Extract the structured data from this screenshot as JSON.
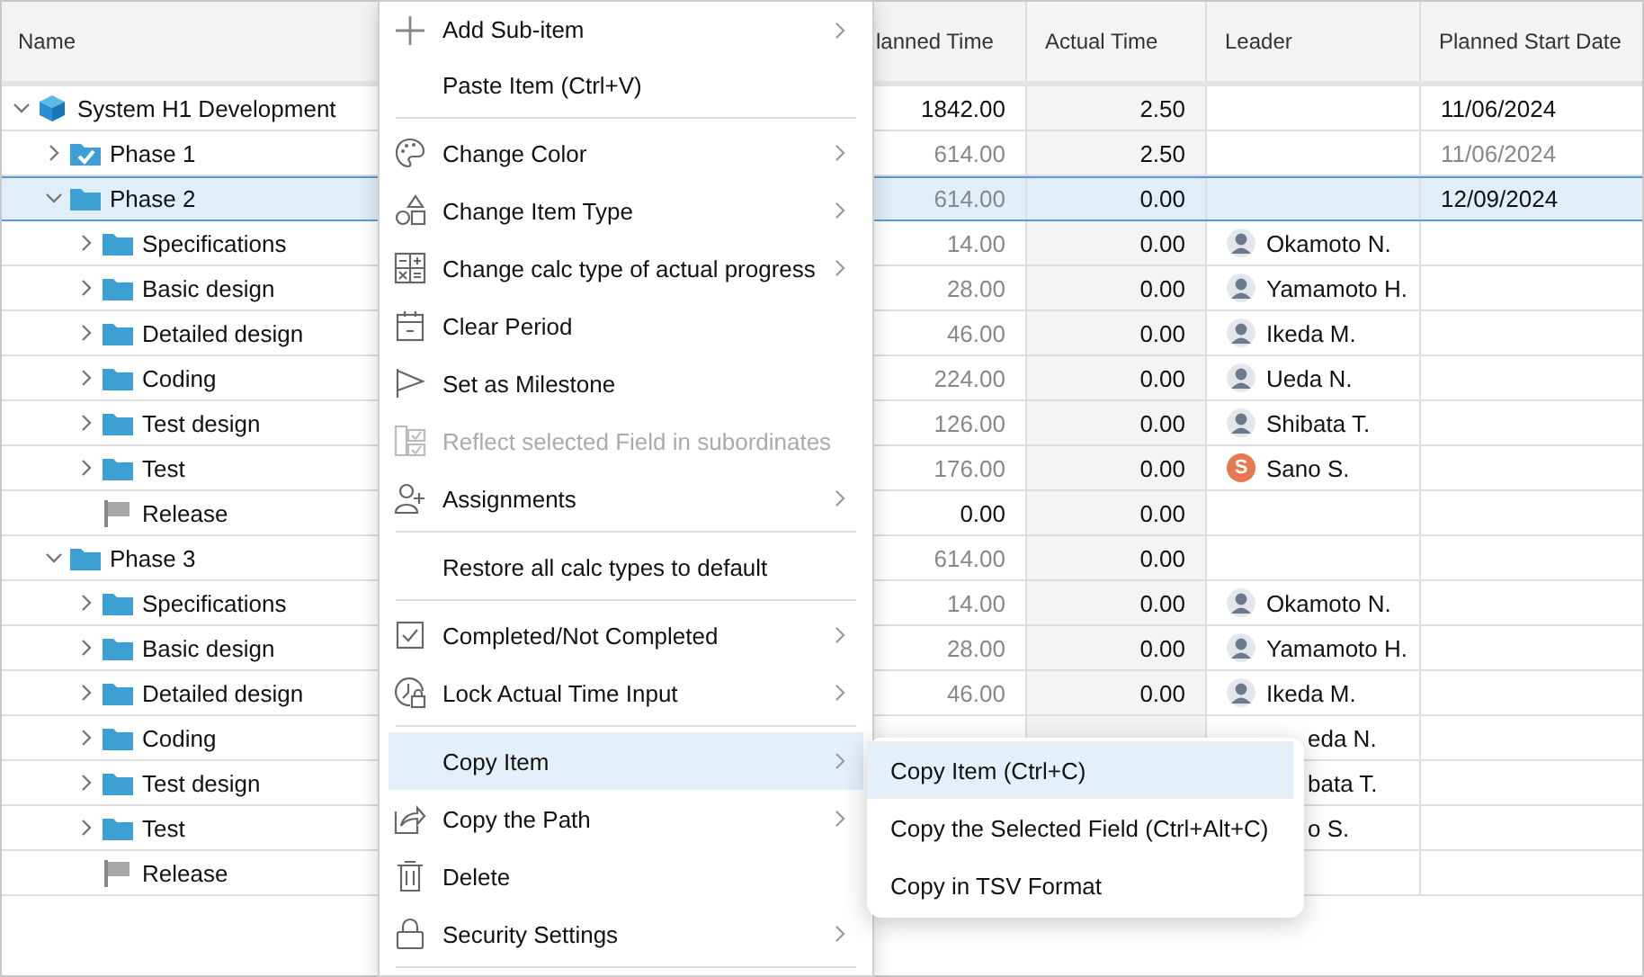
{
  "table": {
    "columns": [
      {
        "label": "Name"
      },
      {
        "label": "lanned Time"
      },
      {
        "label": "Actual Time"
      },
      {
        "label": "Leader"
      },
      {
        "label": "Planned Start Date"
      }
    ],
    "tree": [
      {
        "name": "System H1 Development",
        "kind": "project",
        "expanded": true,
        "selected": false,
        "planned_time": {
          "text": "1842.00",
          "computed": false
        },
        "actual_time": "2.50",
        "start_date": {
          "text": "11/06/2024",
          "computed": false
        },
        "children": [
          {
            "name": "Phase 1",
            "kind": "done-folder",
            "expanded": false,
            "selected": false,
            "planned_time": {
              "text": "614.00",
              "computed": true
            },
            "actual_time": "2.50",
            "start_date": {
              "text": "11/06/2024",
              "computed": true
            }
          },
          {
            "name": "Phase 2",
            "kind": "folder",
            "expanded": true,
            "selected": true,
            "planned_time": {
              "text": "614.00",
              "computed": true
            },
            "actual_time": "0.00",
            "start_date": {
              "text": "12/09/2024",
              "computed": false
            },
            "children": [
              {
                "name": "Specifications",
                "kind": "folder",
                "expanded": false,
                "selected": false,
                "planned_time": {
                  "text": "14.00",
                  "computed": true
                },
                "actual_time": "0.00",
                "leader": {
                  "name": "Okamoto N.",
                  "kind": "figure"
                }
              },
              {
                "name": "Basic design",
                "kind": "folder",
                "expanded": false,
                "selected": false,
                "planned_time": {
                  "text": "28.00",
                  "computed": true
                },
                "actual_time": "0.00",
                "leader": {
                  "name": "Yamamoto H.",
                  "kind": "figure"
                }
              },
              {
                "name": "Detailed design",
                "kind": "folder",
                "expanded": false,
                "selected": false,
                "planned_time": {
                  "text": "46.00",
                  "computed": true
                },
                "actual_time": "0.00",
                "leader": {
                  "name": "Ikeda M.",
                  "kind": "figure"
                }
              },
              {
                "name": "Coding",
                "kind": "folder",
                "expanded": false,
                "selected": false,
                "planned_time": {
                  "text": "224.00",
                  "computed": true
                },
                "actual_time": "0.00",
                "leader": {
                  "name": "Ueda N.",
                  "kind": "figure"
                }
              },
              {
                "name": "Test design",
                "kind": "folder",
                "expanded": false,
                "selected": false,
                "planned_time": {
                  "text": "126.00",
                  "computed": true
                },
                "actual_time": "0.00",
                "leader": {
                  "name": "Shibata T.",
                  "kind": "figure"
                }
              },
              {
                "name": "Test",
                "kind": "folder",
                "expanded": false,
                "selected": false,
                "planned_time": {
                  "text": "176.00",
                  "computed": true
                },
                "actual_time": "0.00",
                "leader": {
                  "name": "Sano S.",
                  "kind": "letter",
                  "letter": "S",
                  "color": "#e8784f"
                }
              },
              {
                "name": "Release",
                "kind": "milestone",
                "selected": false,
                "planned_time": {
                  "text": "0.00",
                  "computed": false
                },
                "actual_time": "0.00"
              }
            ]
          },
          {
            "name": "Phase 3",
            "kind": "folder",
            "expanded": true,
            "selected": false,
            "planned_time": {
              "text": "614.00",
              "computed": true
            },
            "actual_time": "0.00",
            "children": [
              {
                "name": "Specifications",
                "kind": "folder",
                "expanded": false,
                "selected": false,
                "planned_time": {
                  "text": "14.00",
                  "computed": true
                },
                "actual_time": "0.00",
                "leader": {
                  "name": "Okamoto N.",
                  "kind": "figure"
                }
              },
              {
                "name": "Basic design",
                "kind": "folder",
                "expanded": false,
                "selected": false,
                "planned_time": {
                  "text": "28.00",
                  "computed": true
                },
                "actual_time": "0.00",
                "leader": {
                  "name": "Yamamoto H.",
                  "kind": "figure"
                }
              },
              {
                "name": "Detailed design",
                "kind": "folder",
                "expanded": false,
                "selected": false,
                "planned_time": {
                  "text": "46.00",
                  "computed": true
                },
                "actual_time": "0.00",
                "leader": {
                  "name": "Ikeda M.",
                  "kind": "figure"
                }
              },
              {
                "name": "Coding",
                "kind": "folder",
                "expanded": false,
                "selected": false,
                "leader": {
                  "name": "eda N.",
                  "kind": "covered"
                }
              },
              {
                "name": "Test design",
                "kind": "folder",
                "expanded": false,
                "selected": false,
                "leader": {
                  "name": "bata T.",
                  "kind": "covered"
                }
              },
              {
                "name": "Test",
                "kind": "folder",
                "expanded": false,
                "selected": false,
                "leader": {
                  "name": "o S.",
                  "kind": "covered"
                }
              },
              {
                "name": "Release",
                "kind": "milestone",
                "selected": false
              }
            ]
          }
        ]
      }
    ]
  },
  "context_menu": {
    "items": [
      {
        "kind": "plus",
        "label": "Add Sub-item",
        "submenu": true,
        "disabled": false,
        "selected": false
      },
      {
        "kind": "plain",
        "label": "Paste Item (Ctrl+V)",
        "submenu": false,
        "disabled": false,
        "selected": false
      },
      {
        "kind": "separator"
      },
      {
        "kind": "palette",
        "label": "Change Color",
        "submenu": true,
        "disabled": false,
        "selected": false
      },
      {
        "kind": "shapes",
        "label": "Change Item Type",
        "submenu": true,
        "disabled": false,
        "selected": false
      },
      {
        "kind": "calculator",
        "label": "Change calc type of actual progress",
        "submenu": true,
        "disabled": false,
        "selected": false
      },
      {
        "kind": "calendar",
        "label": "Clear Period",
        "submenu": false,
        "disabled": false,
        "selected": false
      },
      {
        "kind": "flag",
        "label": "Set as Milestone",
        "submenu": false,
        "disabled": false,
        "selected": false
      },
      {
        "kind": "checklist",
        "label": "Reflect selected Field in subordinates",
        "submenu": false,
        "disabled": true,
        "selected": false
      },
      {
        "kind": "person",
        "label": "Assignments",
        "submenu": true,
        "disabled": false,
        "selected": false
      },
      {
        "kind": "separator"
      },
      {
        "kind": "plain",
        "label": "Restore all calc types to default",
        "submenu": false,
        "disabled": false,
        "selected": false
      },
      {
        "kind": "separator"
      },
      {
        "kind": "checkbox",
        "label": "Completed/Not Completed",
        "submenu": true,
        "disabled": false,
        "selected": false
      },
      {
        "kind": "clock",
        "label": "Lock Actual Time Input",
        "submenu": true,
        "disabled": false,
        "selected": false
      },
      {
        "kind": "separator"
      },
      {
        "kind": "plain",
        "label": "Copy Item",
        "submenu": true,
        "disabled": false,
        "selected": true
      },
      {
        "kind": "share",
        "label": "Copy the Path",
        "submenu": true,
        "disabled": false,
        "selected": false
      },
      {
        "kind": "trash",
        "label": "Delete",
        "submenu": false,
        "disabled": false,
        "selected": false
      },
      {
        "kind": "lock",
        "label": "Security Settings",
        "submenu": true,
        "disabled": false,
        "selected": false
      },
      {
        "kind": "separator"
      }
    ]
  },
  "submenu": {
    "items": [
      {
        "label": "Copy Item (Ctrl+C)",
        "selected": true
      },
      {
        "label": "Copy the Selected Field (Ctrl+Alt+C)",
        "selected": false
      },
      {
        "label": "Copy in TSV Format",
        "selected": false
      }
    ]
  }
}
